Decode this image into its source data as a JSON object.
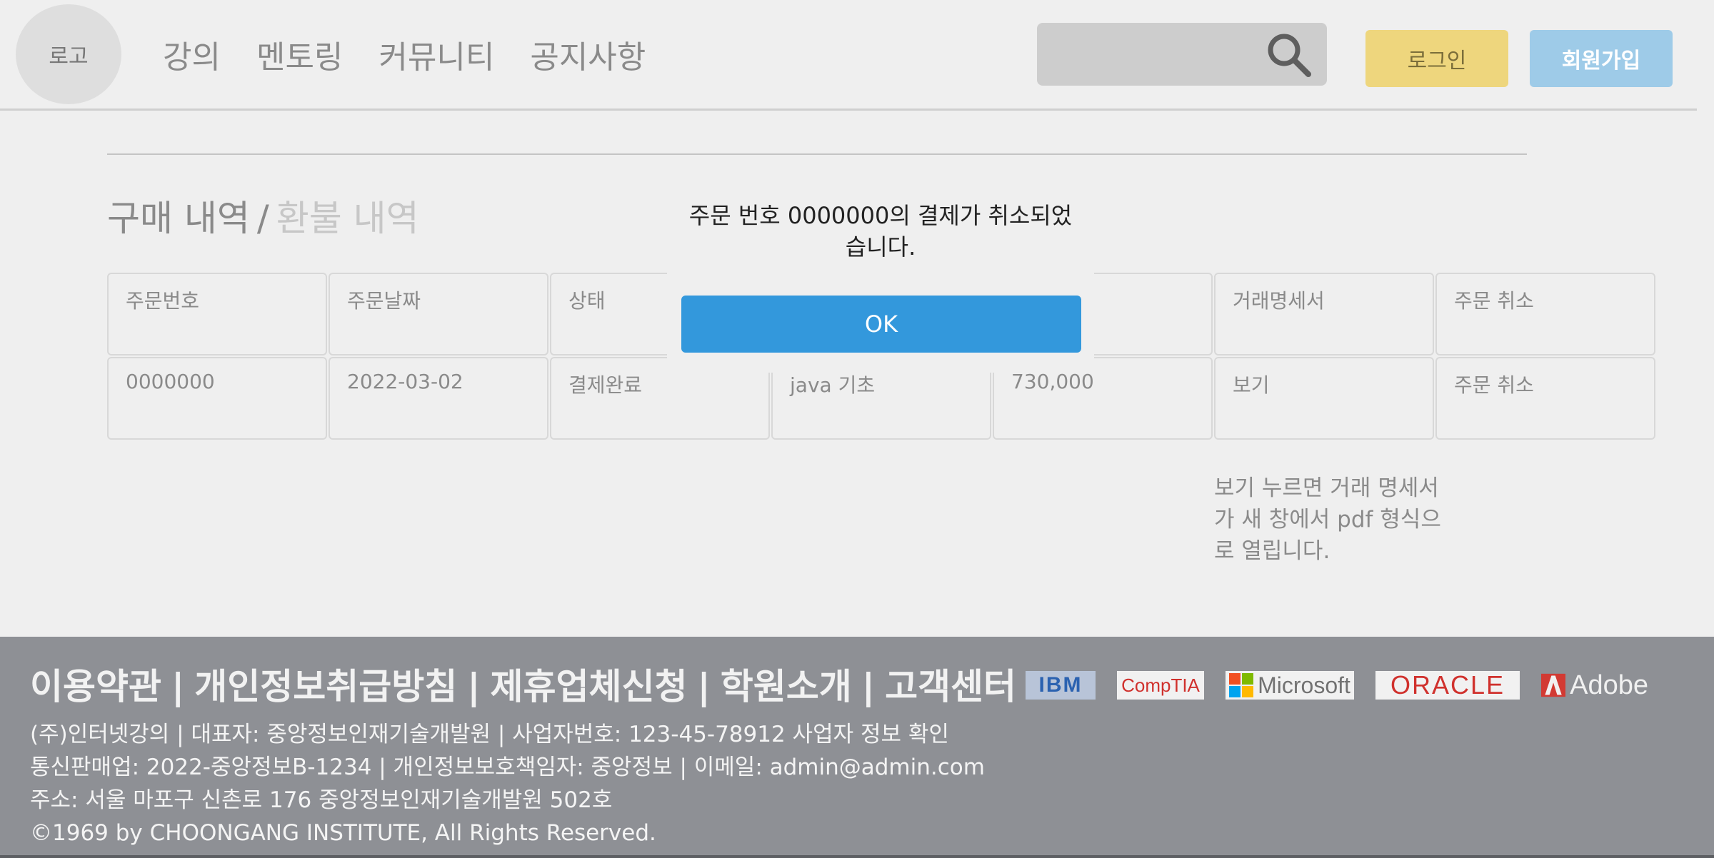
{
  "header": {
    "logo": "로고",
    "nav": [
      "강의",
      "멘토링",
      "커뮤니티",
      "공지사항"
    ],
    "search_placeholder": "",
    "login_label": "로그인",
    "signup_label": "회원가입"
  },
  "section": {
    "active_tab": "구매 내역",
    "separator": "/",
    "inactive_tab": "환불 내역"
  },
  "table": {
    "headers": [
      "주문번호",
      "주문날짜",
      "상태",
      "",
      "",
      "거래명세서",
      "주문 취소"
    ],
    "rows": [
      [
        "0000000",
        "2022-03-02",
        "결제완료",
        "java 기초",
        "730,000",
        "보기",
        "주문 취소"
      ]
    ]
  },
  "note": "보기 누르면 거래 명세서가 새 창에서 pdf 형식으로 열립니다.",
  "modal": {
    "message": "주문 번호 0000000의 결제가 취소되었습니다.",
    "ok_label": "OK"
  },
  "footer": {
    "links": [
      "이용약관",
      "개인정보취급방침",
      "제휴업체신청",
      "학원소개",
      "고객센터"
    ],
    "info": [
      "(주)인터넷강의 | 대표자: 중앙정보인재기술개발원 | 사업자번호: 123-45-78912 사업자 정보 확인",
      "통신판매업: 2022-중앙정보B-1234 | 개인정보보호책임자: 중앙정보 | 이메일: admin@admin.com",
      "주소: 서울 마포구 신촌로 176 중앙정보인재기술개발원 502호",
      "©1969 by CHOONGANG INSTITUTE, All Rights Reserved."
    ],
    "partners": [
      "IBM",
      "CompTIA",
      "Microsoft",
      "ORACLE",
      "Adobe"
    ]
  },
  "colors": {
    "login": "#eed67d",
    "signup": "#9ecbe8",
    "ok_button": "#3398dc",
    "footer_bg": "#8e9095"
  }
}
